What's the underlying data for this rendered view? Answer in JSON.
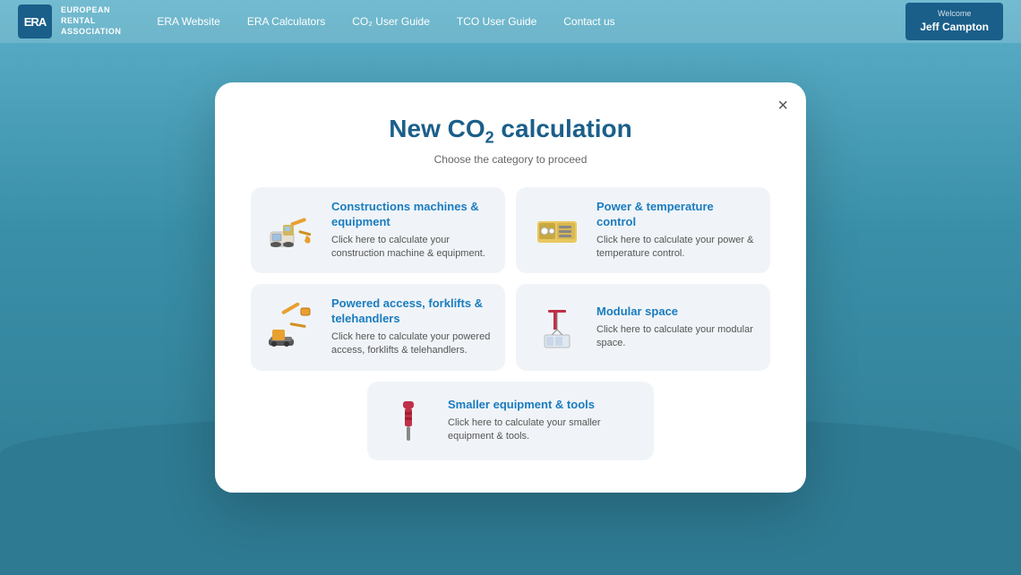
{
  "header": {
    "logo_initials": "ERA",
    "logo_text_line1": "EUROPEAN",
    "logo_text_line2": "RENTAL",
    "logo_text_line3": "ASSOCIATION",
    "nav": [
      {
        "label": "ERA Website"
      },
      {
        "label": "ERA Calculators"
      },
      {
        "label": "CO₂ User Guide"
      },
      {
        "label": "TCO User Guide"
      },
      {
        "label": "Contact us"
      }
    ],
    "welcome_label": "Welcome",
    "user_name": "Jeff Campton"
  },
  "modal": {
    "title_part1": "New CO",
    "title_sub": "2",
    "title_part2": " calculation",
    "subtitle": "Choose the category to proceed",
    "close_label": "×",
    "categories": [
      {
        "id": "construction",
        "title": "Constructions machines & equipment",
        "description": "Click here to calculate your construction machine & equipment."
      },
      {
        "id": "power",
        "title": "Power & temperature control",
        "description": "Click here to calculate your power & temperature control."
      },
      {
        "id": "powered-access",
        "title": "Powered access, forklifts & telehandlers",
        "description": "Click here to calculate your powered access, forklifts & telehandlers."
      },
      {
        "id": "modular",
        "title": "Modular space",
        "description": "Click here to calculate your modular space."
      },
      {
        "id": "smaller-equipment",
        "title": "Smaller equipment & tools",
        "description": "Click here to calculate your smaller equipment & tools."
      }
    ]
  }
}
